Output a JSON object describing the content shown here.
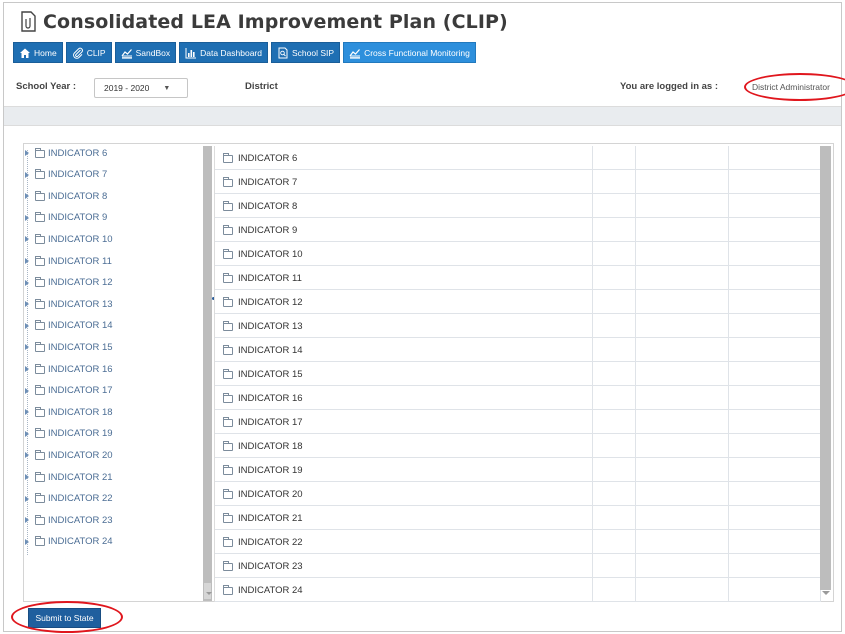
{
  "app": {
    "title": "Consolidated LEA Improvement Plan (CLIP)",
    "title_icon": "document-clip-icon"
  },
  "nav": [
    {
      "label": "Home",
      "icon": "home-icon"
    },
    {
      "label": "CLIP",
      "icon": "paperclip-icon"
    },
    {
      "label": "SandBox",
      "icon": "chart-line-icon"
    },
    {
      "label": "Data Dashboard",
      "icon": "bar-chart-icon"
    },
    {
      "label": "School SIP",
      "icon": "document-search-icon"
    },
    {
      "label": "Cross Functional Monitoring",
      "icon": "chart-line-icon",
      "active": true
    }
  ],
  "filters": {
    "school_year_label": "School Year :",
    "school_year_value": "2019 - 2020",
    "district_label": "District",
    "logged_in_label": "You are logged in as :",
    "role": "District Administrator"
  },
  "tree": [
    "INDICATOR 6",
    "INDICATOR 7",
    "INDICATOR 8",
    "INDICATOR 9",
    "INDICATOR 10",
    "INDICATOR 11",
    "INDICATOR 12",
    "INDICATOR 13",
    "INDICATOR 14",
    "INDICATOR 15",
    "INDICATOR 16",
    "INDICATOR 17",
    "INDICATOR 18",
    "INDICATOR 19",
    "INDICATOR 20",
    "INDICATOR 21",
    "INDICATOR 22",
    "INDICATOR 23",
    "INDICATOR 24"
  ],
  "grid": [
    "INDICATOR 6",
    "INDICATOR 7",
    "INDICATOR 8",
    "INDICATOR 9",
    "INDICATOR 10",
    "INDICATOR 11",
    "INDICATOR 12",
    "INDICATOR 13",
    "INDICATOR 14",
    "INDICATOR 15",
    "INDICATOR 16",
    "INDICATOR 17",
    "INDICATOR 18",
    "INDICATOR 19",
    "INDICATOR 20",
    "INDICATOR 21",
    "INDICATOR 22",
    "INDICATOR 23",
    "INDICATOR 24"
  ],
  "actions": {
    "submit_label": "Submit to State"
  },
  "colors": {
    "nav_button": "#1f6fb3",
    "highlight_ring": "#e0161d",
    "submit_button": "#1f5f9e"
  }
}
